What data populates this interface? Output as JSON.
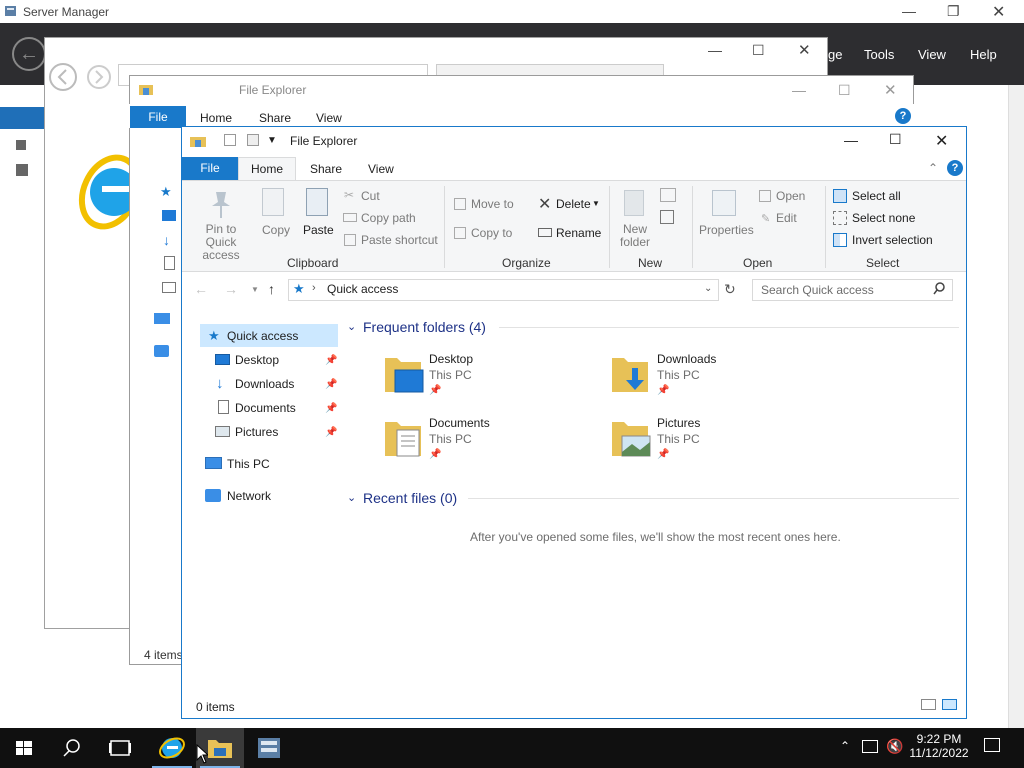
{
  "server_manager": {
    "title": "Server Manager",
    "menu": [
      "ge",
      "Tools",
      "View",
      "Help"
    ]
  },
  "back_explorer": {
    "title": "File Explorer",
    "tabs": [
      "File",
      "Home",
      "Share",
      "View"
    ],
    "status": "4 items"
  },
  "explorer": {
    "title": "File Explorer",
    "tabs": {
      "file": "File",
      "home": "Home",
      "share": "Share",
      "view": "View"
    },
    "ribbon": {
      "clipboard": {
        "pin": "Pin to Quick access",
        "copy": "Copy",
        "paste": "Paste",
        "cut": "Cut",
        "copy_path": "Copy path",
        "paste_shortcut": "Paste shortcut",
        "group": "Clipboard"
      },
      "organize": {
        "move_to": "Move to",
        "copy_to": "Copy to",
        "delete": "Delete",
        "rename": "Rename",
        "group": "Organize"
      },
      "new": {
        "new_folder": "New folder",
        "group": "New"
      },
      "open": {
        "properties": "Properties",
        "open": "Open",
        "edit": "Edit",
        "group": "Open"
      },
      "select": {
        "select_all": "Select all",
        "select_none": "Select none",
        "invert": "Invert selection",
        "group": "Select"
      }
    },
    "address": "Quick access",
    "search_placeholder": "Search Quick access",
    "nav": {
      "quick_access": "Quick access",
      "items": [
        "Desktop",
        "Downloads",
        "Documents",
        "Pictures"
      ],
      "this_pc": "This PC",
      "network": "Network"
    },
    "frequent_title": "Frequent folders (4)",
    "folders": [
      {
        "name": "Desktop",
        "location": "This PC"
      },
      {
        "name": "Downloads",
        "location": "This PC"
      },
      {
        "name": "Documents",
        "location": "This PC"
      },
      {
        "name": "Pictures",
        "location": "This PC"
      }
    ],
    "recent_title": "Recent files (0)",
    "recent_empty": "After you've opened some files, we'll show the most recent ones here.",
    "status": "0 items"
  },
  "taskbar": {
    "time": "9:22 PM",
    "date": "11/12/2022"
  },
  "colors": {
    "accent": "#1979ca",
    "selection": "#cce8ff",
    "taskbar": "#101010",
    "sm_header": "#2d2d30"
  }
}
